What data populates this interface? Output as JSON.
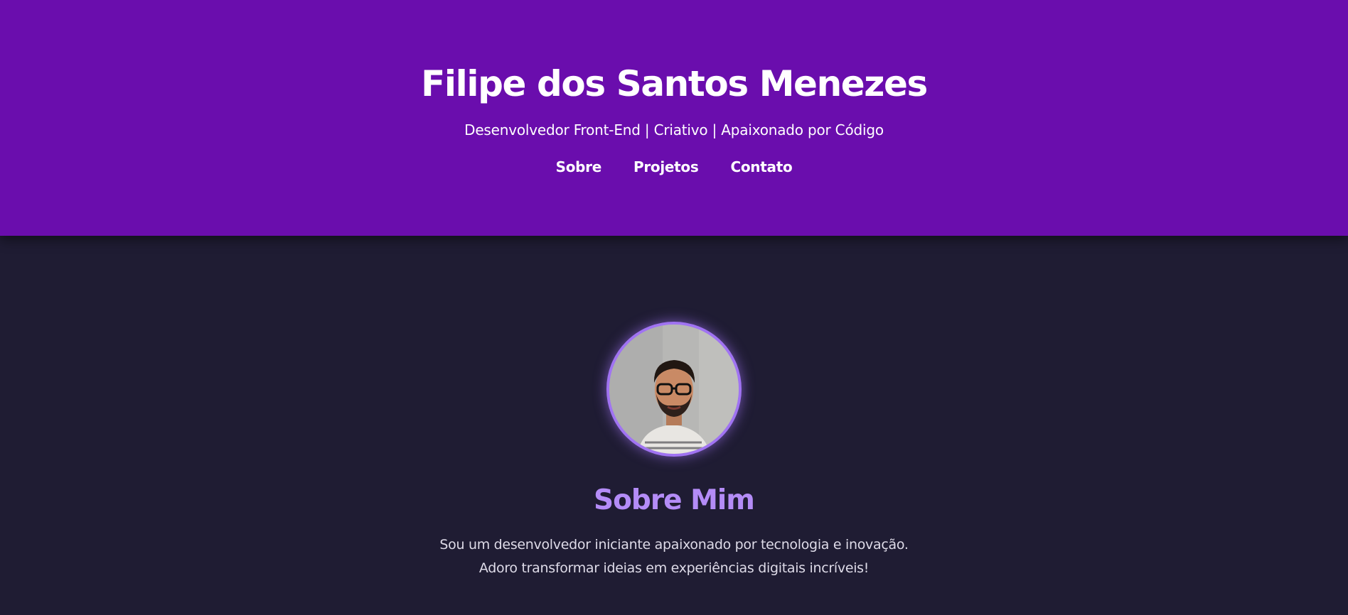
{
  "header": {
    "title": "Filipe dos Santos Menezes",
    "tagline": "Desenvolvedor Front-End | Criativo | Apaixonado por Código",
    "nav": [
      {
        "label": "Sobre"
      },
      {
        "label": "Projetos"
      },
      {
        "label": "Contato"
      }
    ]
  },
  "about": {
    "photo": "profile-photo",
    "title": "Sobre Mim",
    "text_lines": [
      "Sou um desenvolvedor iniciante apaixonado por tecnologia e inovação.",
      "Adoro transformar ideias em experiências digitais incríveis!"
    ]
  },
  "colors": {
    "header_bg": "#6a0dad",
    "page_bg": "#1f1c33",
    "accent": "#a073f2",
    "heading_accent": "#b48cf7",
    "text": "#dedbe8"
  }
}
